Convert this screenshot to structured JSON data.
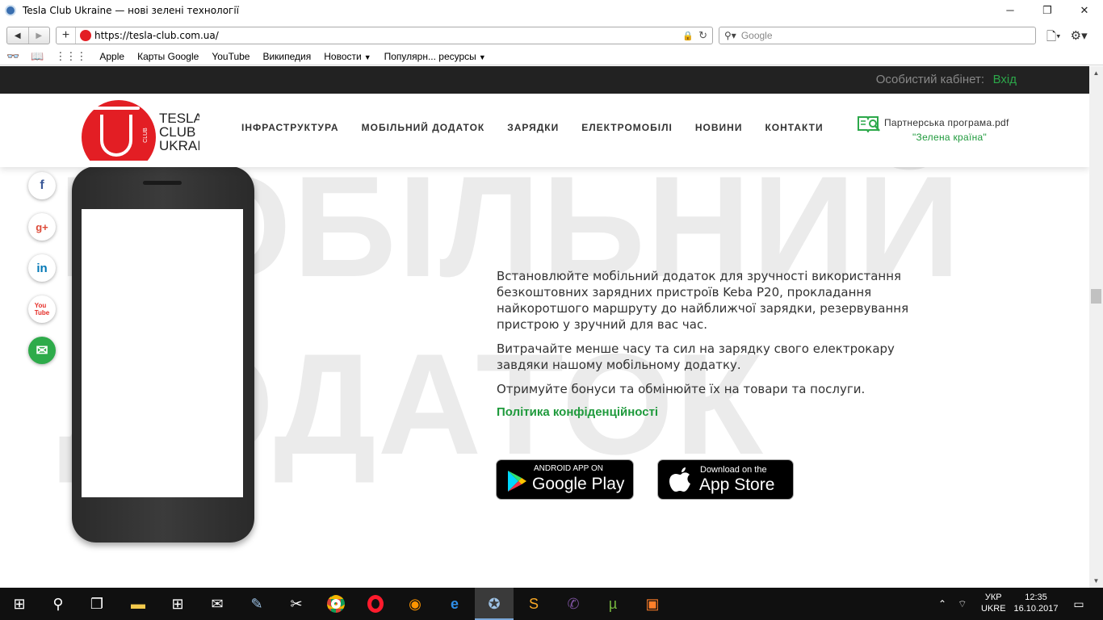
{
  "window": {
    "title": "Tesla Club Ukraine — нові зелені технології",
    "controls": {
      "minimize": "─",
      "restore": "❐",
      "close": "✕"
    }
  },
  "browser": {
    "url": "https://tesla-club.com.ua/",
    "search_placeholder": "Google",
    "bookmarks": [
      {
        "label": "Apple",
        "dropdown": false
      },
      {
        "label": "Карты Google",
        "dropdown": false
      },
      {
        "label": "YouTube",
        "dropdown": false
      },
      {
        "label": "Википедия",
        "dropdown": false
      },
      {
        "label": "Новости",
        "dropdown": true
      },
      {
        "label": "Популярн... ресурсы",
        "dropdown": true
      }
    ]
  },
  "site": {
    "topstrip": {
      "cabinet_label": "Особистий кабінет:",
      "login_label": "Вхід"
    },
    "logo": {
      "line1": "TESLA",
      "line2": "CLUB",
      "line3": "UKRAINE",
      "vertical": "CLUB"
    },
    "nav": [
      "ІНФРАСТРУКТУРА",
      "МОБІЛЬНИЙ ДОДАТОК",
      "ЗАРЯДКИ",
      "ЕЛЕКТРОМОБІЛІ",
      "НОВИНИ",
      "КОНТАКТИ"
    ],
    "partner": {
      "label": "Партнерська програма.pdf",
      "subtitle": "\"Зелена країна\""
    },
    "background_words": [
      "МОБІЛЬНИЙ",
      "ДОДАТОК"
    ],
    "social": [
      "facebook-icon",
      "google-plus-icon",
      "linkedin-icon",
      "youtube-icon",
      "email-icon"
    ],
    "content": {
      "paragraph1": "Встановлюйте мобільний додаток для зручності використання безкоштовних зарядних пристроїв Keba P20, прокладання найкоротшого маршруту до найближчої зарядки, резервування пристрою у зручний для вас час.",
      "paragraph2": "Витрачайте менше часу та сил на зарядку свого електрокару завдяки нашому мобільному додатку.",
      "paragraph3": "Отримуйте бонуси та обмінюйте їх на товари та послуги.",
      "privacy_link": "Політика конфіденційності"
    },
    "stores": {
      "google_play": {
        "small": "ANDROID APP ON",
        "big": "Google Play"
      },
      "app_store": {
        "small": "Download on the",
        "big": "App Store"
      }
    },
    "accent_color": "#1f9a3c",
    "brand_color": "#e31e24"
  },
  "taskbar": {
    "language_line1": "УКР",
    "language_line2": "UKRE",
    "time": "12:35",
    "date": "16.10.2017",
    "apps": [
      "start-icon",
      "search-icon",
      "task-view-icon",
      "file-explorer-icon",
      "store-icon",
      "mail-icon",
      "paint-icon",
      "snipping-icon",
      "chrome-icon",
      "opera-icon",
      "firefox-icon",
      "edge-icon",
      "safari-icon",
      "sublime-icon",
      "viber-icon",
      "utorrent-icon",
      "app-icon"
    ]
  }
}
